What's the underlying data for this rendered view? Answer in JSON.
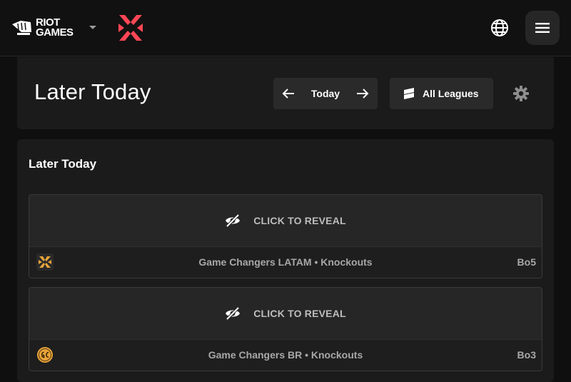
{
  "nav": {
    "brand_line1": "RIOT",
    "brand_line2": "GAMES",
    "icons": [
      "riot-fist-icon",
      "caret-down-icon",
      "valorant-logo",
      "globe-icon",
      "menu-icon"
    ]
  },
  "header": {
    "title": "Later Today",
    "date_label": "Today",
    "leagues_label": "All Leagues"
  },
  "schedule": {
    "section_title": "Later Today",
    "matches": [
      {
        "reveal_label": "CLICK TO REVEAL",
        "league": "Game Changers LATAM • Knockouts",
        "format": "Bo5",
        "icon": "vct-gold-logo"
      },
      {
        "reveal_label": "CLICK TO REVEAL",
        "league": "Game Changers BR • Knockouts",
        "format": "Bo3",
        "icon": "gc-badge-logo"
      }
    ]
  },
  "colors": {
    "background": "#0f0f0f",
    "card": "#1b1b1b",
    "button": "#2a2a2a",
    "valorant_red": "#ff4655",
    "gold": "#e8a33a"
  }
}
